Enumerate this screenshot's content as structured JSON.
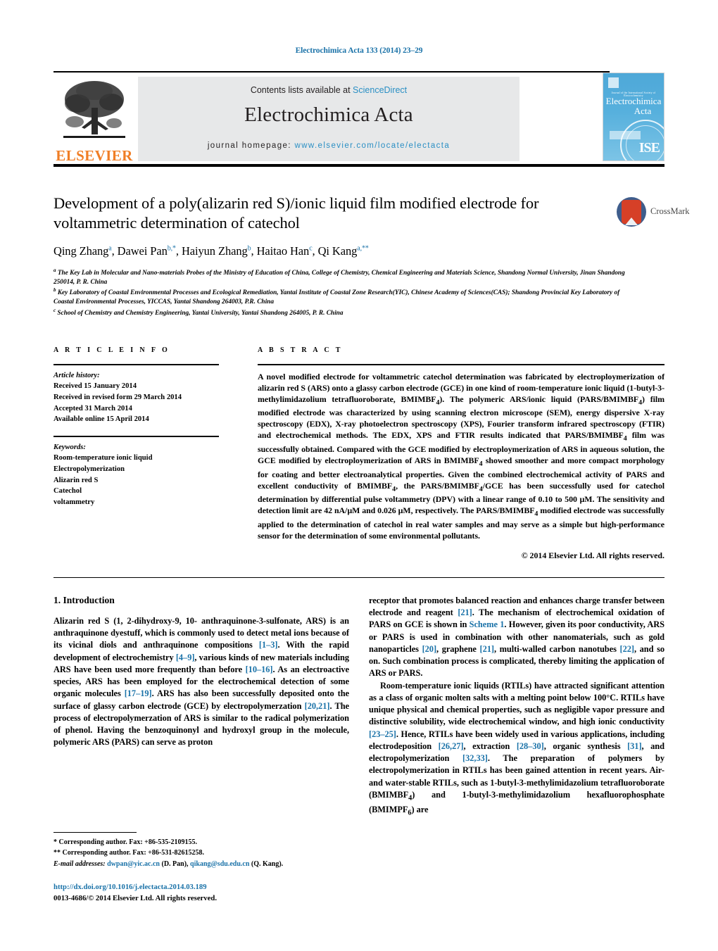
{
  "running_head": "Electrochimica Acta 133 (2014) 23–29",
  "masthead": {
    "contents_prefix": "Contents lists available at ",
    "sciencedirect": "ScienceDirect",
    "journal_name": "Electrochimica Acta",
    "homepage_prefix": "journal homepage: ",
    "homepage_url": "www.elsevier.com/locate/electacta",
    "publisher": "ELSEVIER",
    "cover": {
      "supline": "Journal of the International Society of Electrochemistry",
      "title_line1": "Electrochimica",
      "title_line2": "Acta",
      "society_mark": "ISE"
    },
    "colors": {
      "band_bg": "#e7e8e9",
      "link_blue": "#2a8fc4",
      "elsevier_orange": "#f07e26",
      "cover_blue": "#57b0dd"
    }
  },
  "article": {
    "title": "Development of a poly(alizarin red S)/ionic liquid film modified electrode for voltammetric determination of catechol",
    "authors_html": "Qing Zhang<sup>a</sup>, Dawei Pan<sup>b,*</sup>, Haiyun Zhang<sup>b</sup>, Haitao Han<sup>c</sup>, Qi Kang<sup>a,**</sup>",
    "affiliations": [
      "<sup>a</sup> The Key Lab in Molecular and Nano-materials Probes of the Ministry of Education of China, College of Chemistry, Chemical Engineering and Materials Science, Shandong Normal University, Jinan Shandong 250014, P. R. China",
      "<sup>b</sup> Key Laboratory of Coastal Environmental Processes and Ecological Remediation, Yantai Institute of Coastal Zone Research(YIC), Chinese Academy of Sciences(CAS); Shandong Provincial Key Laboratory of Coastal Environmental Processes, YICCAS, Yantai Shandong 264003, P.R. China",
      "<sup>c</sup> School of Chemistry and Chemistry Engineering, Yantai University, Yantai Shandong 264005, P. R. China"
    ],
    "crossmark_label": "CrossMark"
  },
  "info": {
    "heading": "A R T I C L E   I N F O",
    "history_label": "Article history:",
    "history": [
      "Received 15 January 2014",
      "Received in revised form 29 March 2014",
      "Accepted 31 March 2014",
      "Available online 15 April 2014"
    ],
    "keywords_label": "Keywords:",
    "keywords": [
      "Room-temperature ionic liquid",
      "Electropolymerization",
      "Alizarin red S",
      "Catechol",
      "voltammetry"
    ]
  },
  "abstract": {
    "heading": "A B S T R A C T",
    "text_html": "A novel modified electrode for voltammetric catechol determination was fabricated by electroploymerization of alizarin red S (ARS) onto a glassy carbon electrode (GCE) in one kind of room-temperature ionic liquid (1-butyl-3-methylimidazolium tetrafluoroborate, BMIMBF<sub>4</sub>). The polymeric ARS/ionic liquid (PARS/BMIMBF<sub>4</sub>) film modified electrode was characterized by using scanning electron microscope (SEM), energy dispersive X-ray spectroscopy (EDX), X-ray photoelectron spectroscopy (XPS), Fourier transform infrared spectroscopy (FTIR) and electrochemical methods. The EDX, XPS and FTIR results indicated that PARS/BMIMBF<sub>4</sub> film was successfully obtained. Compared with the GCE modified by electroploymerization of ARS in aqueous solution, the GCE modified by electroploymerization of ARS in BMIMBF<sub>4</sub> showed smoother and more compact morphology for coating and better electroanalytical properties. Given the combined electrochemical activity of PARS and excellent conductivity of BMIMBF<sub>4</sub>, the PARS/BMIMBF<sub>4</sub>/GCE has been successfully used for catechol determination by differential pulse voltammetry (DPV) with a linear range of 0.10 to 500 &micro;M. The sensitivity and detection limit are 42 nA/&micro;M and 0.026 &micro;M, respectively. The PARS/BMIMBF<sub>4</sub> modified electrode was successfully applied to the determination of catechol in real water samples and may serve as a simple but high-performance sensor for the determination of some environmental pollutants.",
    "copyright": "© 2014 Elsevier Ltd. All rights reserved."
  },
  "body": {
    "section_number_title": "1. Introduction",
    "left_paragraphs_html": [
      "Alizarin red S (1, 2-dihydroxy-9, 10- anthraquinone-3-sulfonate, ARS) is an anthraquinone dyestuff, which is commonly used to detect metal ions because of its vicinal diols and anthraquinone compositions <span class=\"ref\">[1–3]</span>. With the rapid development of electrochemistry <span class=\"ref\">[4–9]</span>, various kinds of new materials including ARS have been used more frequently than before <span class=\"ref\">[10–16]</span>. As an electroactive species, ARS has been employed for the electrochemical detection of some organic molecules <span class=\"ref\">[17–19]</span>. ARS has also been successfully deposited onto the surface of glassy carbon electrode (GCE) by electropolymerzation <span class=\"ref\">[20,21]</span>. The process of electropolymerzation of ARS is similar to the radical polymerization of phenol. Having the benzoquinonyl and hydroxyl group in the molecule, polymeric ARS (PARS) can serve as proton"
    ],
    "right_paragraphs_html": [
      "receptor that promotes balanced reaction and enhances charge transfer between electrode and reagent <span class=\"ref\">[21]</span>. The mechanism of electrochemical oxidation of PARS on GCE is shown in <span class=\"lnk\">Scheme 1</span>. However, given its poor conductivity, ARS or PARS is used in combination with other nanomaterials, such as gold nanoparticles <span class=\"ref\">[20]</span>, graphene <span class=\"ref\">[21]</span>, multi-walled carbon nanotubes <span class=\"ref\">[22]</span>, and so on. Such combination process is complicated, thereby limiting the application of ARS or PARS.",
      "Room-temperature ionic liquids (RTILs) have attracted significant attention as a class of organic molten salts with a melting point below 100&deg;C. RTILs have unique physical and chemical properties, such as negligible vapor pressure and distinctive solubility, wide electrochemical window, and high ionic conductivity <span class=\"ref\">[23–25]</span>. Hence, RTILs have been widely used in various applications, including electrodeposition <span class=\"ref\">[26,27]</span>, extraction <span class=\"ref\">[28–30]</span>, organic synthesis <span class=\"ref\">[31]</span>, and electropolymerization <span class=\"ref\">[32,33]</span>. The preparation of polymers by electropolymerization in RTILs has been gained attention in recent years. Air- and water-stable RTILs, such as 1-butyl-3-methylimidazolium tetrafluoroborate (BMIMBF<sub>4</sub>) and 1-butyl-3-methylimidazolium hexafluorophosphate (BMIMPF<sub>6</sub>) are"
    ]
  },
  "footnotes": {
    "lines_html": [
      "* Corresponding author. Fax: +86-535-2109155.",
      "** Corresponding author. Fax: +86-531-82615258.",
      "<span class=\"em\">E-mail addresses:</span> <span class=\"lnk\">dwpan@yic.ac.cn</span> (D. Pan), <span class=\"lnk\">qikang@sdu.edu.cn</span> (Q. Kang)."
    ],
    "doi": "http://dx.doi.org/10.1016/j.electacta.2014.03.189",
    "issn_line": "0013-4686/© 2014 Elsevier Ltd. All rights reserved."
  }
}
